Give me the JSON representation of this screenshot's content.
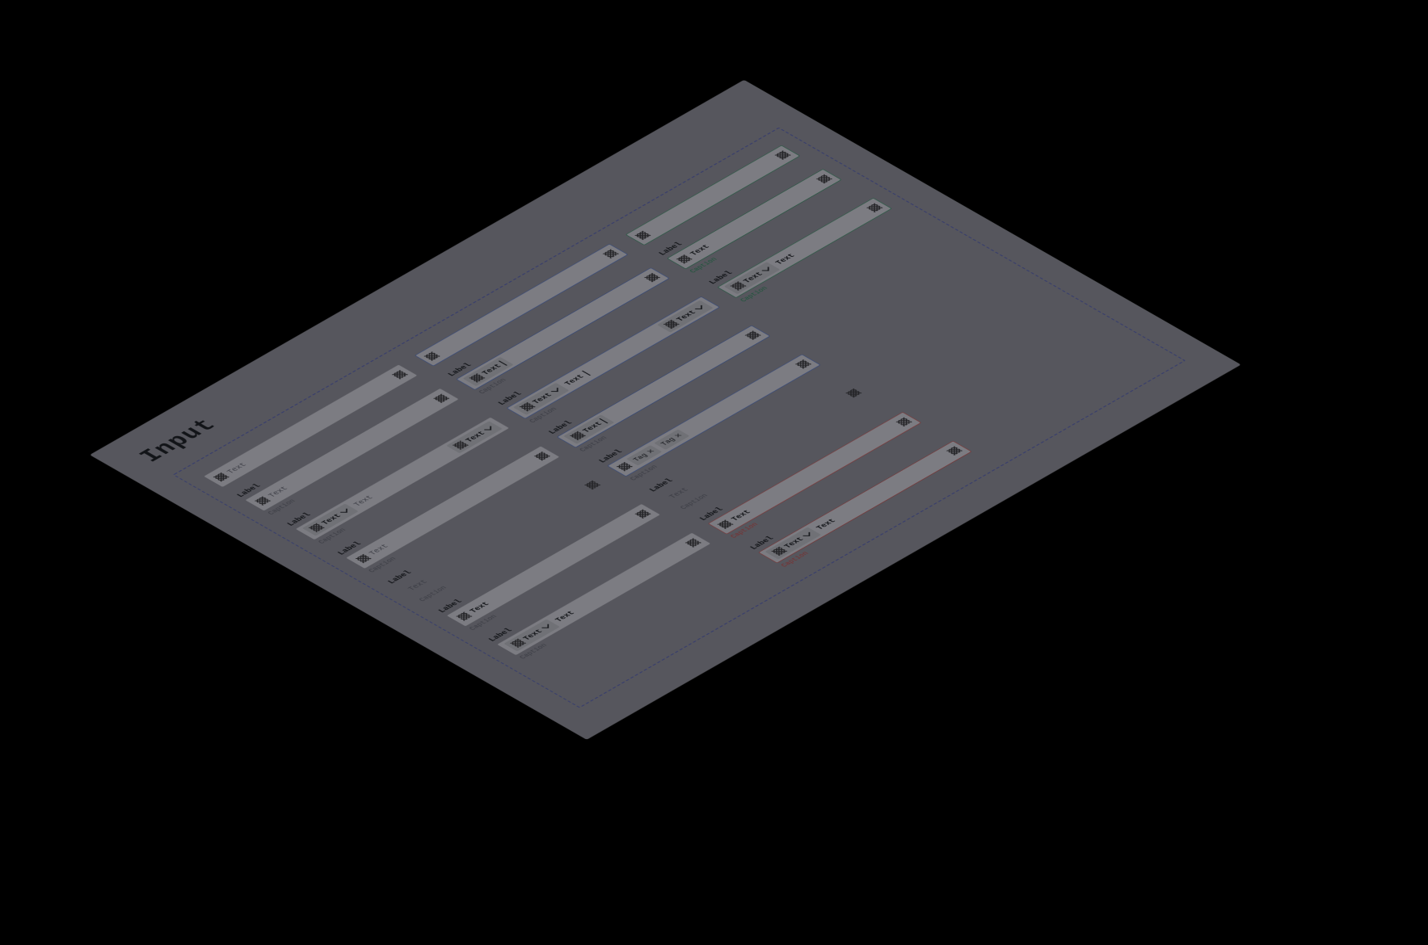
{
  "title": "Input",
  "label": "Label",
  "caption": "Caption",
  "text": "Text",
  "tag": "Tag",
  "placeholder": "Text"
}
